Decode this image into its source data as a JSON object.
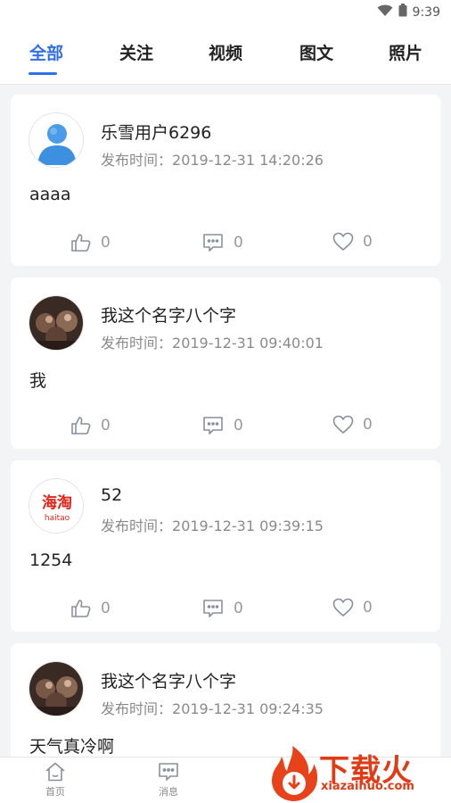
{
  "status_bar": {
    "time": "9:39",
    "wifi_icon": "wifi-icon",
    "battery_icon": "battery-icon"
  },
  "tabs": [
    {
      "label": "全部",
      "active": true
    },
    {
      "label": "关注",
      "active": false
    },
    {
      "label": "视频",
      "active": false
    },
    {
      "label": "图文",
      "active": false
    },
    {
      "label": "照片",
      "active": false
    }
  ],
  "posts": [
    {
      "username": "乐雪用户6296",
      "time_label": "发布时间：",
      "time": "2019-12-31 14:20:26",
      "content": "aaaa",
      "likes": "0",
      "comments": "0",
      "favorites": "0",
      "avatar": "default-user-avatar"
    },
    {
      "username": "我这个名字八个字",
      "time_label": "发布时间：",
      "time": "2019-12-31 09:40:01",
      "content": "我",
      "likes": "0",
      "comments": "0",
      "favorites": "0",
      "avatar": "photo-avatar"
    },
    {
      "username": "52",
      "time_label": "发布时间：",
      "time": "2019-12-31 09:39:15",
      "content": "1254",
      "likes": "0",
      "comments": "0",
      "favorites": "0",
      "avatar": "haitao-logo-avatar",
      "avatar_logo_text": "海淘",
      "avatar_logo_sub": "haitao"
    },
    {
      "username": "我这个名字八个字",
      "time_label": "发布时间：",
      "time": "2019-12-31 09:24:35",
      "content": "天气真冷啊",
      "avatar": "photo-avatar"
    }
  ],
  "bottom_nav": [
    {
      "label": "首页",
      "icon": "home-icon"
    },
    {
      "label": "消息",
      "icon": "message-icon"
    }
  ],
  "watermark": {
    "title": "下载火",
    "url": "xiazaihuo.com"
  },
  "colors": {
    "accent": "#2f6fe8",
    "watermark": "#e23a14"
  }
}
